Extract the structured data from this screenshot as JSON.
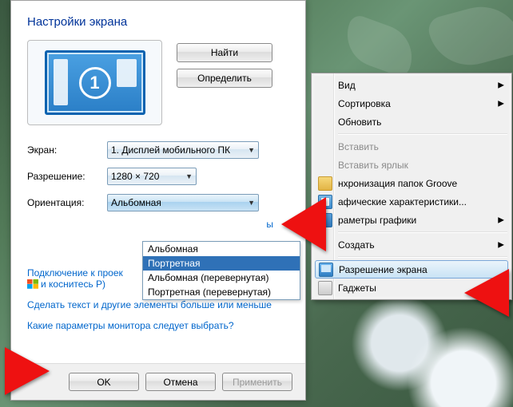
{
  "dialog": {
    "title": "Настройки экрана",
    "monitor_number": "1",
    "buttons": {
      "find": "Найти",
      "detect": "Определить"
    },
    "rows": {
      "display_label": "Экран:",
      "display_value": "1. Дисплей мобильного ПК",
      "resolution_label": "Разрешение:",
      "resolution_value": "1280 × 720",
      "orientation_label": "Ориентация:",
      "orientation_value": "Альбомная"
    },
    "orientation_options": {
      "o0": "Альбомная",
      "o1": "Портретная",
      "o2": "Альбомная (перевернутая)",
      "o3": "Портретная (перевернутая)"
    },
    "links": {
      "proj_line1": "Подключение к проек",
      "proj_line2": "и коснитесь P)",
      "text_size": "Сделать текст и другие элементы больше или меньше",
      "which_settings": "Какие параметры монитора следует выбрать?",
      "advanced": "ы"
    },
    "footer": {
      "ok": "OK",
      "cancel": "Отмена",
      "apply": "Применить"
    }
  },
  "context_menu": {
    "view": "Вид",
    "sort": "Сортировка",
    "refresh": "Обновить",
    "paste": "Вставить",
    "paste_shortcut": "Вставить ярлык",
    "groove": "нхронизация папок Groove",
    "gfx_props": "афические характеристики...",
    "gfx_params": "раметры графики",
    "new": "Создать",
    "screen_res": "Разрешение экрана",
    "gadgets": "Гаджеты"
  }
}
